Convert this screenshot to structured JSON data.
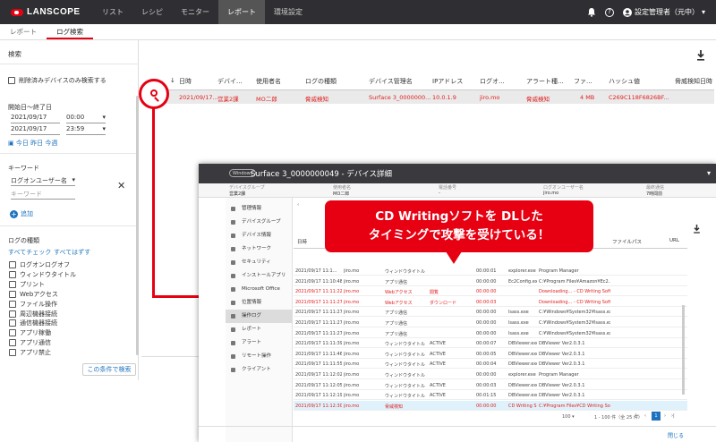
{
  "topbar": {
    "logo": "LANSCOPE",
    "nav": [
      "リスト",
      "レシピ",
      "モニター",
      "レポート",
      "環境設定"
    ],
    "active_nav": "レポート",
    "user": "設定管理者（元中）"
  },
  "subtabs": [
    "レポート",
    "ログ検索"
  ],
  "search": {
    "title": "検索",
    "deleted_only_label": "削除済みデバイスのみ検索する",
    "period_label": "開始日〜終了日",
    "start_date": "2021/09/17",
    "start_time": "00:00",
    "end_date": "2021/09/17",
    "end_time": "23:59",
    "quick_links": [
      "今日",
      "昨日",
      "今週"
    ],
    "keyword_label": "キーワード",
    "keyword_type": "ログオンユーザー名",
    "keyword_placeholder": "キーワード",
    "add_label": "追加",
    "log_type_label": "ログの種類",
    "check_all": "すべてチェック",
    "uncheck_all": "すべてはずす",
    "log_types": [
      "ログオンログオフ",
      "ウィンドウタイトル",
      "プリント",
      "Webアクセス",
      "ファイル操作",
      "周辺機器接続",
      "通信機器接続",
      "アプリ稼働",
      "アプリ通信",
      "アプリ禁止"
    ],
    "submit_label": "この条件で検索"
  },
  "table": {
    "headers": [
      "日時",
      "デバイ...",
      "使用者名",
      "ログの種類",
      "デバイス管理名",
      "IPアドレス",
      "ログオ...",
      "アラート種...",
      "ファ...",
      "ハッシュ値",
      "脅威検知日時"
    ],
    "row": [
      "2021/09/17...",
      "営業2課",
      "MO二郎",
      "脅威検知",
      "Surface 3_0000000...",
      "10.0.1.9",
      "jiro.mo",
      "脅威検知",
      "4 MB",
      "C269C118F6826BF...",
      ""
    ]
  },
  "detail": {
    "badge": "Windows",
    "title": "Surface 3_0000000049 - デバイス詳細",
    "meta_labels": [
      "デバイスグループ",
      "使用者名",
      "電話番号",
      "ログオンユーザー名",
      "最終通信"
    ],
    "meta_values": [
      "営業2課",
      "MO二郎",
      "-",
      "jiro.mo",
      "7時間前"
    ],
    "sidebar": [
      "管理情報",
      "デバイスグループ",
      "デバイス情報",
      "ネットワーク",
      "セキュリティ",
      "インストールアプリ",
      "Microsoft Office",
      "位置情報",
      "操作ログ",
      "レポート",
      "アラート",
      "リモート操作",
      "クライアント"
    ],
    "active_side": "操作ログ",
    "date_header": "日時",
    "file_path_header": "ファイルパス",
    "url_header": "URL",
    "rows": [
      [
        "2021/09/17 11:1...",
        "jiro.mo",
        "ウィンドウタイトル",
        "",
        "00:00:01",
        "explorer.exe",
        "Program Manager"
      ],
      [
        "2021/09/17 11:10:48",
        "jiro.mo",
        "アプリ通信",
        "",
        "00:00:00",
        "Ec2Config.exe",
        "C:¥Program Files¥Amazon¥Ec2..."
      ],
      [
        "2021/09/17 11:11:22",
        "jiro.mo",
        "Webアクセス",
        "閲覧",
        "00:00:00",
        "",
        "Downloading... - CD Writing Soft..."
      ],
      [
        "2021/09/17 11:11:27",
        "jiro.mo",
        "Webアクセス",
        "ダウンロード",
        "00:00:03",
        "",
        "Downloading... - CD Writing Soft..."
      ],
      [
        "2021/09/17 11:11:27",
        "jiro.mo",
        "アプリ通信",
        "",
        "00:00:00",
        "lsass.exe",
        "C:¥Windows¥System32¥lsass.exe"
      ],
      [
        "2021/09/17 11:11:27",
        "jiro.mo",
        "アプリ通信",
        "",
        "00:00:00",
        "lsass.exe",
        "C:¥Windows¥System32¥lsass.exe"
      ],
      [
        "2021/09/17 11:11:27",
        "jiro.mo",
        "アプリ通信",
        "",
        "00:00:00",
        "lsass.exe",
        "C:¥Windows¥System32¥lsass.exe"
      ],
      [
        "2021/09/17 11:11:39",
        "jiro.mo",
        "ウィンドウタイトル",
        "ACTIVE",
        "00:00:07",
        "DBViewer.exe",
        "DBViewer Ver2.0.3.1"
      ],
      [
        "2021/09/17 11:11:46",
        "jiro.mo",
        "ウィンドウタイトル",
        "ACTIVE",
        "00:00:05",
        "DBViewer.exe",
        "DBViewer Ver2.0.3.1"
      ],
      [
        "2021/09/17 11:11:55",
        "jiro.mo",
        "ウィンドウタイトル",
        "ACTIVE",
        "00:00:04",
        "DBViewer.exe",
        "DBViewer Ver2.0.3.1"
      ],
      [
        "2021/09/17 11:12:02",
        "jiro.mo",
        "ウィンドウタイトル",
        "",
        "00:00:00",
        "explorer.exe",
        "Program Manager"
      ],
      [
        "2021/09/17 11:12:05",
        "jiro.mo",
        "ウィンドウタイトル",
        "ACTIVE",
        "00:00:03",
        "DBViewer.exe",
        "DBViewer Ver2.0.3.1"
      ],
      [
        "2021/09/17 11:12:19",
        "jiro.mo",
        "ウィンドウタイトル",
        "ACTIVE",
        "00:01:15",
        "DBViewer.exe",
        "DBViewer Ver2.0.3.1"
      ],
      [
        "2021/09/17 11:12:30",
        "jiro.mo",
        "脅威検知",
        "",
        "00:00:00",
        "CD Writing S...",
        "C:¥Program Files¥CD Writing Soft..."
      ]
    ],
    "page_size": "100",
    "page_range": "1 - 100 件（全 25 件）",
    "current_page": "1",
    "close_label": "閉じる"
  },
  "callout": {
    "line1": "CD Writingソフトを DLした",
    "line2": "タイミングで攻撃を受けている！"
  },
  "colors": {
    "accent": "#e60012",
    "link": "#1e73be",
    "topbar": "#2f2f33"
  }
}
